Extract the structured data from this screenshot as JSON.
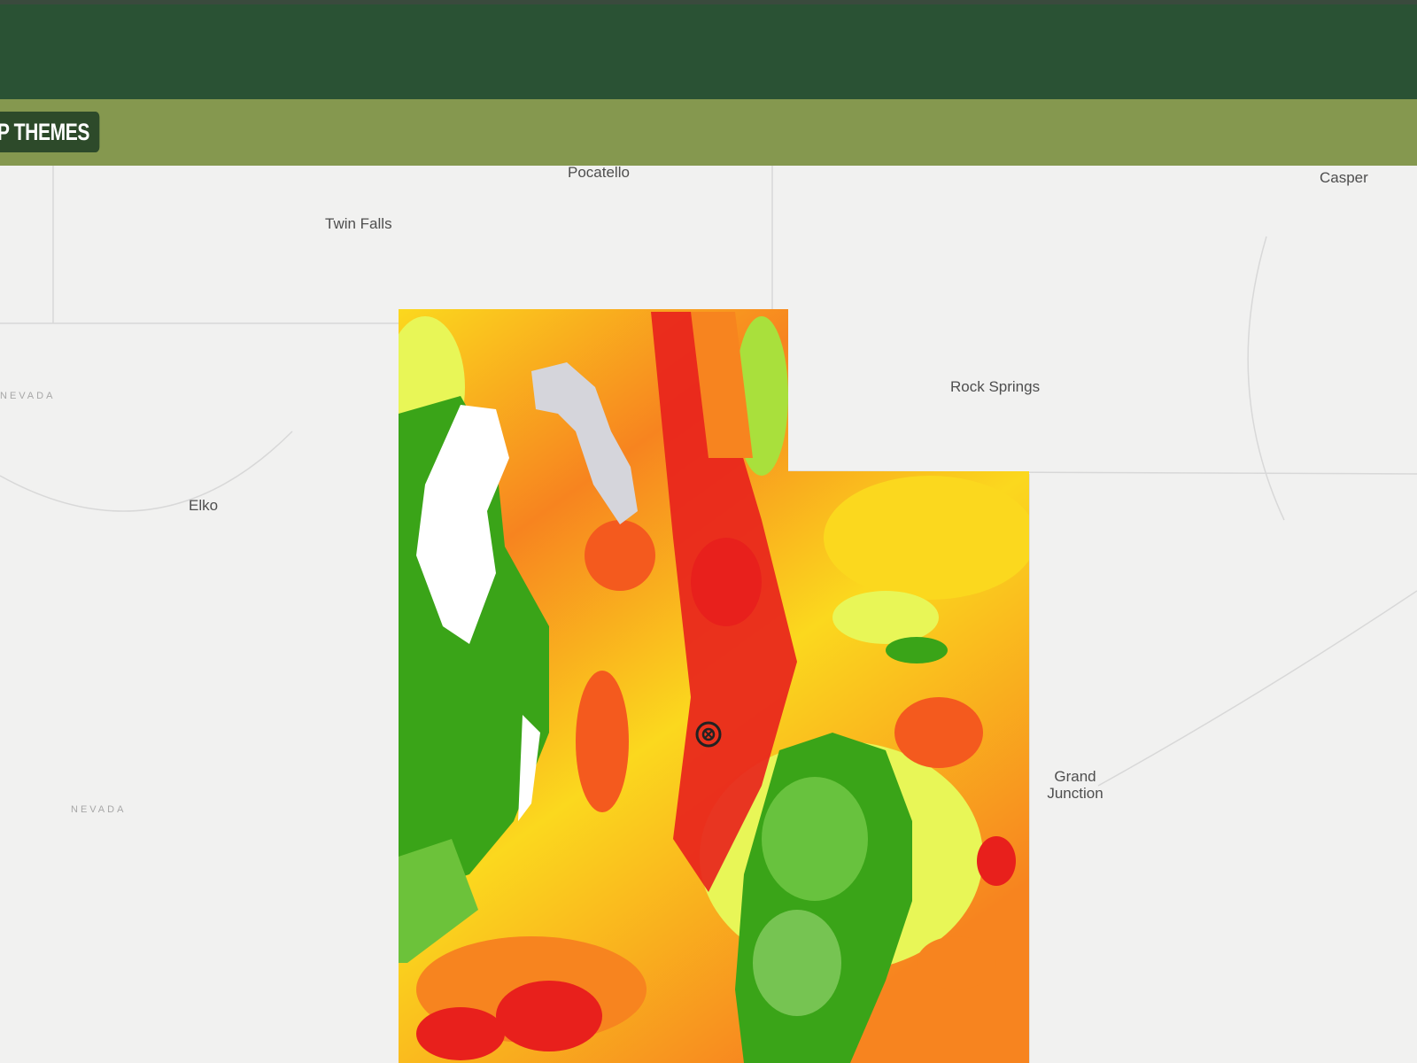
{
  "header": {
    "bg_color": "#2a5234"
  },
  "toolbar": {
    "bg_color": "#85984f",
    "map_themes_label": "P THEMES"
  },
  "map": {
    "cities": [
      {
        "key": "pocatello",
        "label": "Pocatello"
      },
      {
        "key": "casper",
        "label": "Casper"
      },
      {
        "key": "twin_falls",
        "label": "Twin Falls"
      },
      {
        "key": "rock_springs",
        "label": "Rock Springs"
      },
      {
        "key": "elko",
        "label": "Elko"
      },
      {
        "key": "grand_junction",
        "label": "Grand Junction"
      }
    ],
    "states": {
      "nevada_1": "NEVADA",
      "nevada_2": "NEVADA"
    },
    "legend_colors": {
      "high": "#e8201c",
      "mid_high": "#f7841f",
      "mid": "#fbd81e",
      "low_mid": "#e8f657",
      "low": "#3aa418",
      "water": "#d5d5db"
    },
    "marker_icon": "location-target-icon"
  }
}
